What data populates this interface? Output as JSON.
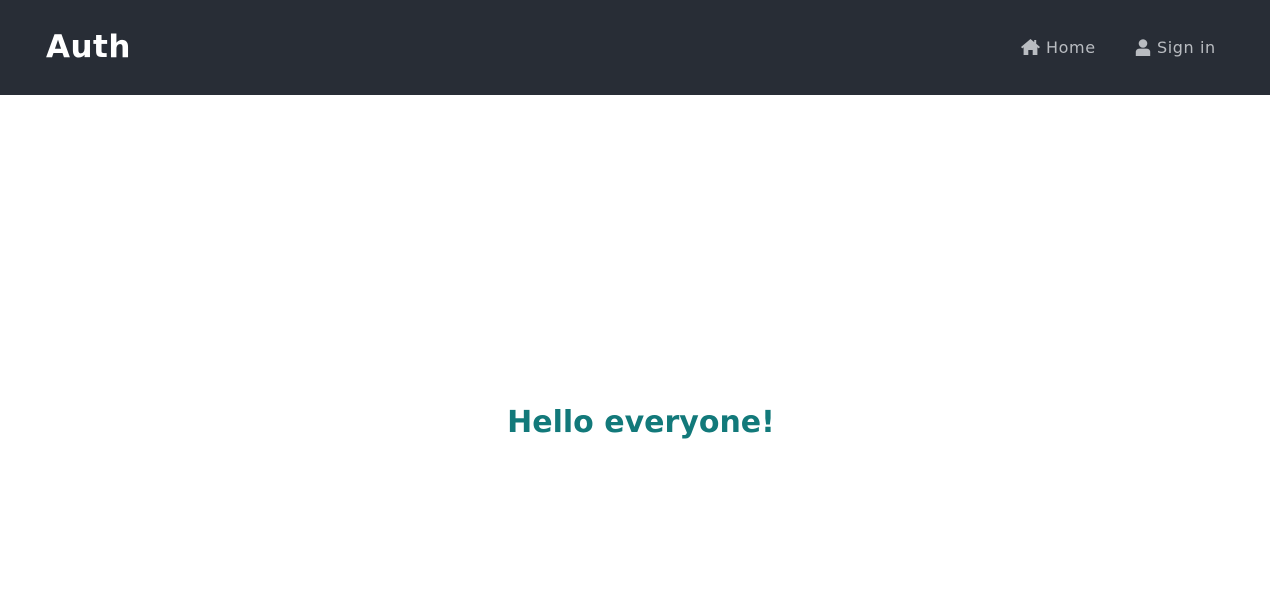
{
  "navbar": {
    "brand": "Auth",
    "links": [
      {
        "label": "Home",
        "icon": "home-icon"
      },
      {
        "label": "Sign in",
        "icon": "user-icon"
      }
    ],
    "background_color": "#282d36",
    "link_color": "#b9bcc1"
  },
  "main": {
    "heading": "Hello everyone!",
    "heading_color": "#12797a"
  }
}
